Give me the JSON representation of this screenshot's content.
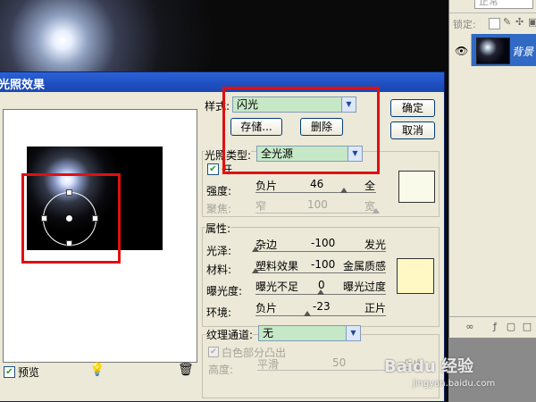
{
  "layers_panel": {
    "blend_mode": "正常",
    "lock_label": "锁定:",
    "layer_name": "背景"
  },
  "dialog": {
    "title": "光照效果",
    "style_label": "样式:",
    "style_value": "闪光",
    "save_button": "存储...",
    "delete_button": "删除",
    "ok_button": "确定",
    "cancel_button": "取消",
    "light_type_label": "光照类型:",
    "light_type_value": "全光源",
    "on_label": "开",
    "intensity": {
      "label": "强度:",
      "min": "负片",
      "value": "46",
      "max": "全",
      "fraction": 0.73
    },
    "focus": {
      "label": "聚焦:",
      "min": "窄",
      "value": "100",
      "max": "宽",
      "fraction": 1.0
    },
    "properties_label": "属性:",
    "gloss": {
      "label": "光泽:",
      "min": "杂边",
      "value": "-100",
      "max": "发光",
      "fraction": 0.0
    },
    "material": {
      "label": "材料:",
      "min": "塑料效果",
      "value": "-100",
      "max": "金属质感",
      "fraction": 0.0
    },
    "exposure": {
      "label": "曝光度:",
      "min": "曝光不足",
      "value": "0",
      "max": "曝光过度",
      "fraction": 0.5
    },
    "ambience": {
      "label": "环境:",
      "min": "负片",
      "value": "-23",
      "max": "正片",
      "fraction": 0.4
    },
    "texture_channel_label": "纹理通道:",
    "texture_channel_value": "无",
    "white_high_label": "白色部分凸出",
    "height": {
      "label": "高度:",
      "min": "平滑",
      "value": "50",
      "max": "凸出",
      "fraction": 0.5
    },
    "preview_label": "预览",
    "light_color": "#fafaea",
    "property_color": "#fff8c4"
  },
  "watermark": {
    "main": "Baidu 经验",
    "sub": "jingyan.baidu.com"
  }
}
